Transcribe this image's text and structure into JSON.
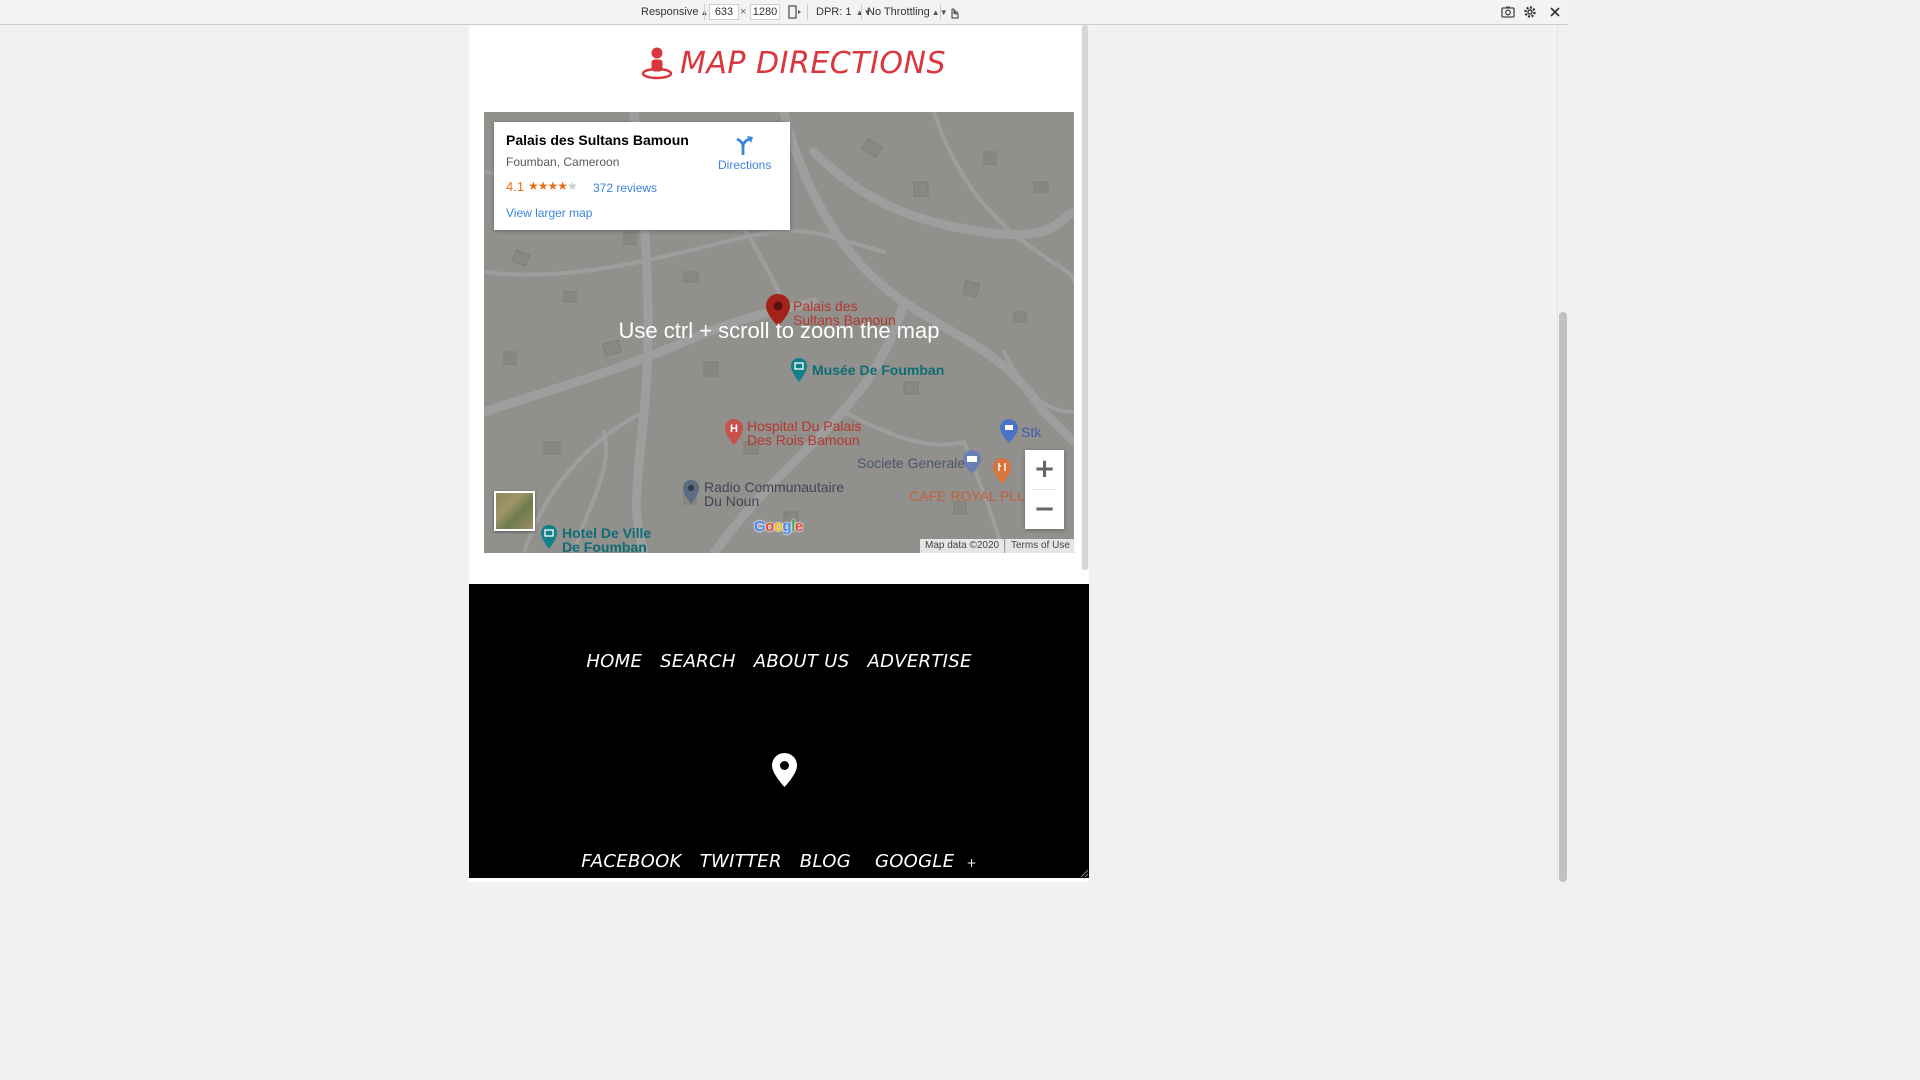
{
  "devtools": {
    "device": "Responsive",
    "width": "633",
    "times": "×",
    "height": "1280",
    "dpr": "DPR: 1",
    "throttle": "No Throttling"
  },
  "section": {
    "title": "MAP DIRECTIONS"
  },
  "map": {
    "place_name": "Palais des Sultans Bamoun",
    "address": "Foumban, Cameroon",
    "rating": "4.1",
    "stars_on": "★★★★",
    "stars_off": "★",
    "reviews": "372 reviews",
    "view_larger": "View larger map",
    "directions": "Directions",
    "zoom_message": "Use ctrl + scroll to zoom the map",
    "pois": {
      "palais_line1": "Palais des",
      "palais_line2": "Sultans Bamoun",
      "musee": "Musée De Foumban",
      "hospital_line1": "Hospital Du Palais",
      "hospital_line2": "Des Rois Bamoun",
      "stk": "Stk",
      "societe": "Societe Generale",
      "radio_line1": "Radio Communautaire",
      "radio_line2": "Du Noun",
      "cafe": "CAFE ROYAL PLUS",
      "hotel_line1": "Hotel De Ville",
      "hotel_line2": "De Foumban"
    },
    "zoom_in": "+",
    "zoom_out": "−",
    "map_data": "Map data ©2020",
    "terms": "Terms of Use",
    "google": {
      "g1": "G",
      "o1": "o",
      "o2": "o",
      "g2": "g",
      "l": "l",
      "e": "e"
    }
  },
  "footer": {
    "nav": [
      "HOME",
      "SEARCH",
      "ABOUT US",
      "ADVERTISE"
    ],
    "social": [
      "FACEBOOK",
      "TWITTER",
      "BLOG",
      "GOOGLE"
    ],
    "social_plus": "+"
  },
  "colors": {
    "accent_red": "#d9363e",
    "link_blue": "#3a84df",
    "star_orange": "#e7711b"
  }
}
